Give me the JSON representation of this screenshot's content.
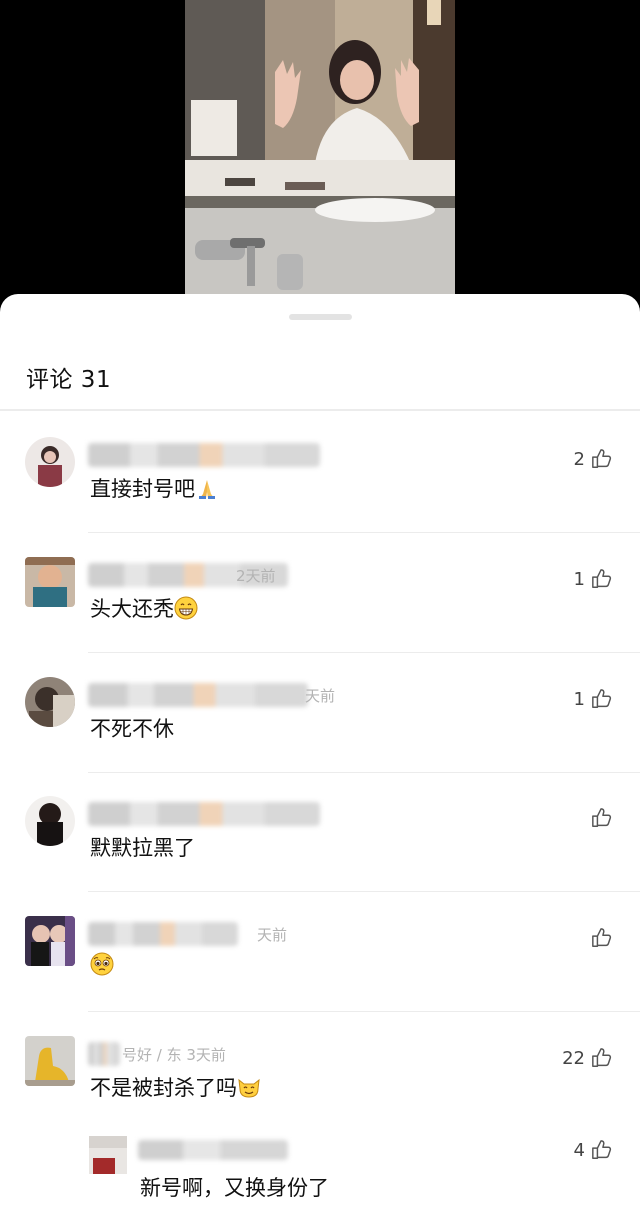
{
  "video": {
    "alt": "video frame: woman at bathroom mirror raising both hands"
  },
  "panel": {
    "title": "评论 31"
  },
  "comments": [
    {
      "time": "",
      "text": "直接封号吧",
      "emoji": "folded-hands-emoji",
      "likes": "2"
    },
    {
      "time": "2天前",
      "text": "头大还秃",
      "emoji": "grinning-face-emoji",
      "likes": "1"
    },
    {
      "time": "天前",
      "text": "不死不休",
      "emoji": "",
      "likes": "1"
    },
    {
      "time": "",
      "text": "默默拉黑了",
      "emoji": "",
      "likes": ""
    },
    {
      "time": "天前",
      "text": "",
      "emoji": "pleading-face-emoji",
      "likes": ""
    },
    {
      "time": "号好 / 东 3天前",
      "text": "不是被封杀了吗",
      "emoji": "cat-face-emoji",
      "likes": "22"
    }
  ],
  "reply": {
    "text": "新号啊，又换身份了",
    "likes": "4"
  },
  "colors": {
    "sheet_bg": "#ffffff",
    "text": "#111111",
    "muted": "#b3b3b3",
    "divider": "#ececec"
  }
}
